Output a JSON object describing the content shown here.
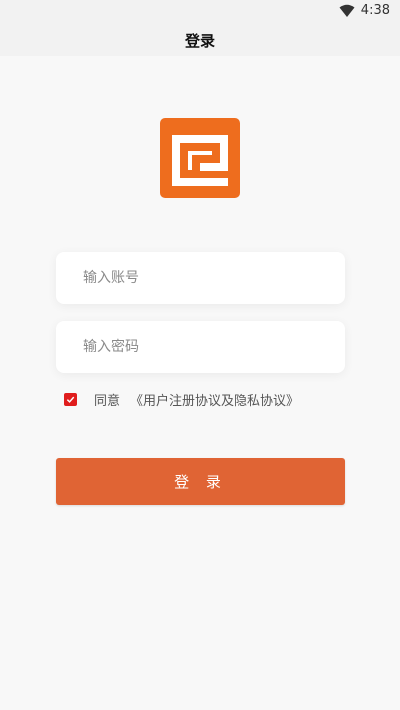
{
  "status_bar": {
    "time": "4:38",
    "icons": [
      "wifi-icon"
    ]
  },
  "app_bar": {
    "title": "登录"
  },
  "logo": {
    "icon": "brand-logo-icon",
    "color": "#ee6d1e"
  },
  "form": {
    "account_placeholder": "输入账号",
    "account_value": "",
    "password_placeholder": "输入密码",
    "password_value": ""
  },
  "agreement": {
    "checked": true,
    "agree_label": "同意",
    "link_label": "《用户注册协议及隐私协议》",
    "checkbox_color": "#e01d1d"
  },
  "login_button": {
    "label": "登 录",
    "color": "#e06434"
  }
}
